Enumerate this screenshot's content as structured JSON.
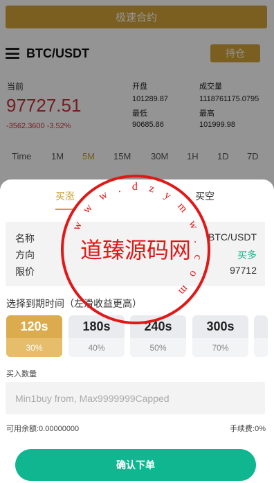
{
  "banner": {
    "label": "极速合约"
  },
  "header": {
    "pair": "BTC/USDT",
    "hold_label": "持仓"
  },
  "ticker": {
    "current_label": "当前",
    "price": "97727.51",
    "change": "-3562.3600 -3.52%",
    "open_label": "开盘",
    "open": "101289.87",
    "low_label": "最低",
    "low": "90685.86",
    "volume_label": "成交量",
    "volume": "1118761175.0795",
    "high_label": "最高",
    "high": "101999.98"
  },
  "timeframes": [
    "Time",
    "1M",
    "5M",
    "15M",
    "30M",
    "1H",
    "1D",
    "7D"
  ],
  "active_timeframe": "5M",
  "sheet": {
    "tab_buy": "买涨",
    "tab_sell": "买空",
    "info": [
      {
        "k": "名称",
        "v": "BTC/USDT"
      },
      {
        "k": "方向",
        "v": "买多"
      },
      {
        "k": "限价",
        "v": "97712"
      }
    ],
    "expiry_title": "选择到期时间（左滑收益更高）",
    "expiry_options": [
      {
        "time": "120s",
        "pct": "30%"
      },
      {
        "time": "180s",
        "pct": "40%"
      },
      {
        "time": "240s",
        "pct": "50%"
      },
      {
        "time": "300s",
        "pct": "70%"
      }
    ],
    "qty_title": "买入数量",
    "qty_placeholder": "Min1buy from, Max9999999Capped",
    "balance": "可用余额:0.00000000",
    "fee": "手续费:0%",
    "confirm_label": "确认下单"
  },
  "watermark": {
    "text": "道臻源码网",
    "ring_text": "w w w . d z y m w . c o m"
  },
  "colors": {
    "gold": "#d4a43a",
    "red": "#c8323a",
    "green": "#10b690"
  }
}
